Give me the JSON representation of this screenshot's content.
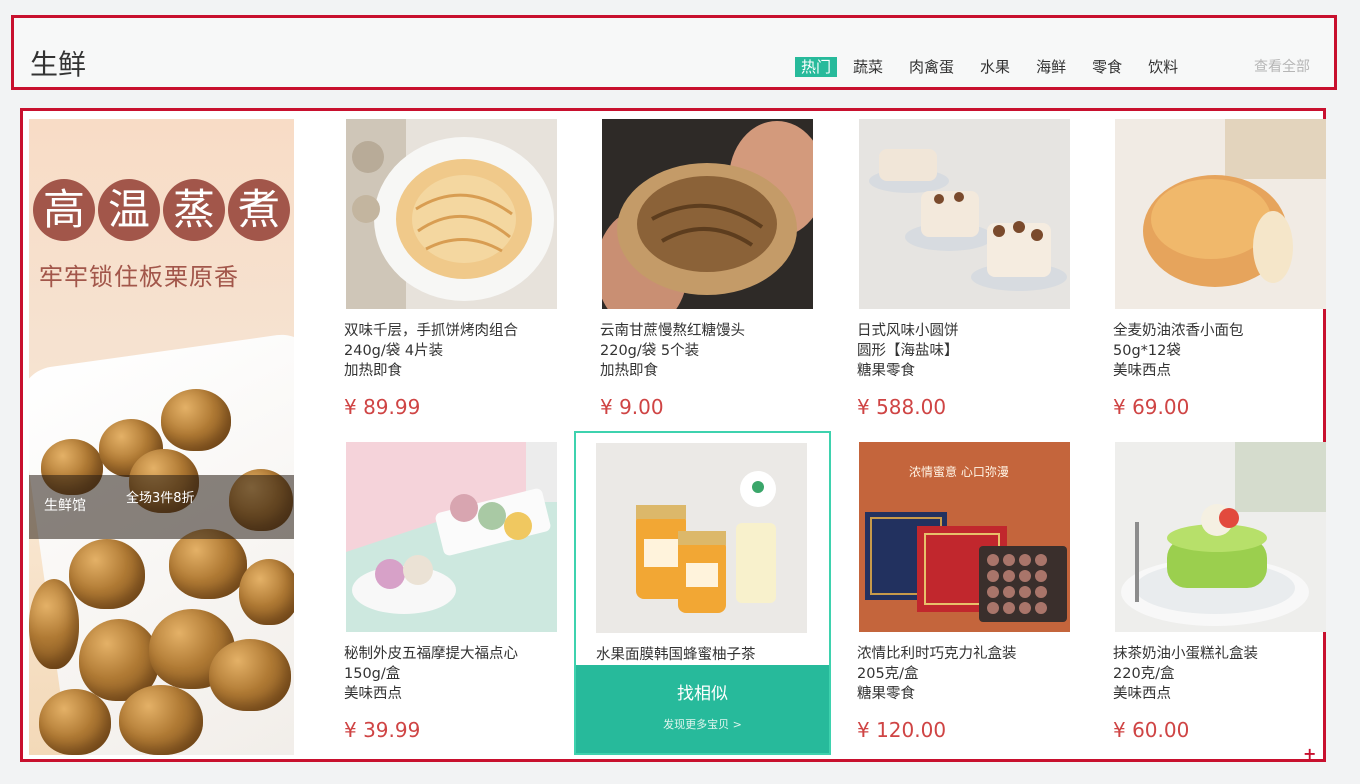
{
  "section": {
    "title": "生鲜",
    "tabs": [
      {
        "label": "热门",
        "active": true
      },
      {
        "label": "蔬菜",
        "active": false
      },
      {
        "label": "肉禽蛋",
        "active": false
      },
      {
        "label": "水果",
        "active": false
      },
      {
        "label": "海鲜",
        "active": false
      },
      {
        "label": "零食",
        "active": false
      },
      {
        "label": "饮料",
        "active": false
      }
    ],
    "view_all": "查看全部"
  },
  "banner": {
    "headline_chars": [
      "高",
      "温",
      "蒸",
      "煮"
    ],
    "subtitle": "牢牢锁住板栗原香",
    "store": "生鲜馆",
    "deal": "全场3件8折"
  },
  "products": [
    {
      "lines": [
        "双味千层，手抓饼烤肉组合",
        "240g/袋 4片装",
        "加热即食"
      ],
      "price": "¥ 89.99",
      "icon": "flatbread-image"
    },
    {
      "lines": [
        "云南甘蔗慢熬红糖馒头",
        "220g/袋 5个装",
        "加热即食"
      ],
      "price": "¥ 9.00",
      "icon": "steamed-bun-image"
    },
    {
      "lines": [
        "日式风味小圆饼",
        "圆形【海盐味】",
        "糖果零食"
      ],
      "price": "¥ 588.00",
      "icon": "mini-cake-image"
    },
    {
      "lines": [
        "全麦奶油浓香小面包",
        "50g*12袋",
        "美味西点"
      ],
      "price": "¥ 69.00",
      "icon": "bread-image"
    },
    {
      "lines": [
        "秘制外皮五福摩提大福点心",
        "150g/盒",
        "美味西点"
      ],
      "price": "¥ 39.99",
      "icon": "mochi-image"
    },
    {
      "lines": [
        "水果面膜韩国蜂蜜柚子茶"
      ],
      "price": "",
      "icon": "honey-jar-image",
      "hover": {
        "title": "找相似",
        "subtitle": "发现更多宝贝 >"
      }
    },
    {
      "lines": [
        "浓情比利时巧克力礼盒装",
        "205克/盒",
        "糖果零食"
      ],
      "price": "¥ 120.00",
      "icon": "chocolate-box-image",
      "box_text": "浓情蜜意 心口弥漫"
    },
    {
      "lines": [
        "抹茶奶油小蛋糕礼盒装",
        "220克/盒",
        "美味西点"
      ],
      "price": "¥ 60.00",
      "icon": "matcha-cake-image"
    }
  ],
  "colors": {
    "accent": "#27ba9b",
    "price": "#cf4444",
    "outline": "#c8102e"
  }
}
